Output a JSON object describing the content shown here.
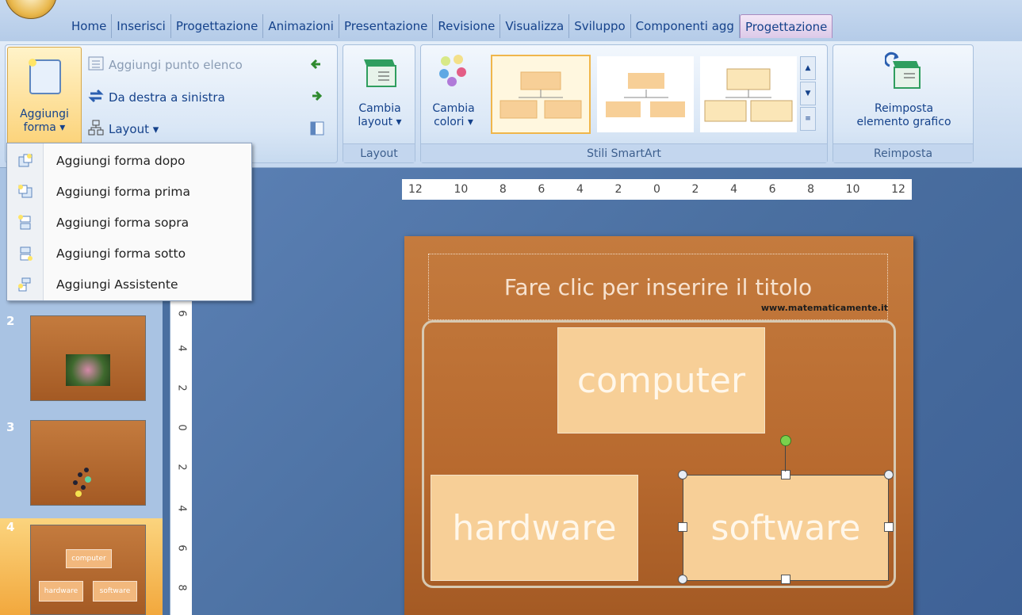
{
  "tabs": [
    "Home",
    "Inserisci",
    "Progettazione",
    "Animazioni",
    "Presentazione",
    "Revisione",
    "Visualizza",
    "Sviluppo",
    "Componenti agg",
    "Progettazione"
  ],
  "ribbon": {
    "create_group": {
      "add_shape_line1": "Aggiungi",
      "add_shape_line2": "forma ▾",
      "add_bullet": "Aggiungi punto elenco",
      "right_to_left": "Da destra a sinistra",
      "layout": "Layout ▾"
    },
    "layout_group": {
      "label": "Layout",
      "change_layout_line1": "Cambia",
      "change_layout_line2": "layout ▾"
    },
    "styles_group": {
      "label": "Stili SmartArt",
      "change_colors_line1": "Cambia",
      "change_colors_line2": "colori ▾"
    },
    "reset_group": {
      "label": "Reimposta",
      "reset_line1": "Reimposta",
      "reset_line2": "elemento grafico"
    }
  },
  "menu": {
    "items": [
      {
        "label": "Aggiungi forma dopo",
        "icon": "add-shape-after-icon"
      },
      {
        "label": "Aggiungi forma prima",
        "icon": "add-shape-before-icon"
      },
      {
        "label": "Aggiungi forma sopra",
        "icon": "add-shape-above-icon"
      },
      {
        "label": "Aggiungi forma sotto",
        "icon": "add-shape-below-icon"
      },
      {
        "label": "Aggiungi Assistente",
        "icon": "add-assistant-icon"
      }
    ]
  },
  "slides": [
    {
      "number": "2"
    },
    {
      "number": "3"
    },
    {
      "number": "4",
      "box_top": "computer",
      "box_left": "hardware",
      "box_right": "software"
    }
  ],
  "hruler_ticks": [
    "12",
    "10",
    "8",
    "6",
    "4",
    "2",
    "0",
    "2",
    "4",
    "6",
    "8",
    "10",
    "12"
  ],
  "vruler_ticks": [
    "6",
    "4",
    "2",
    "0",
    "2",
    "4",
    "6",
    "8"
  ],
  "slide": {
    "title_placeholder": "Fare clic per inserire il titolo",
    "watermark": "www.matematicamente.it",
    "box_top": "computer",
    "box_left": "hardware",
    "box_right": "software"
  },
  "colors": {
    "slide_bg": "#b86a2f",
    "box_fill": "#f7cf97",
    "ribbon_bg": "#dae7f6",
    "accent_text": "#15428b"
  }
}
